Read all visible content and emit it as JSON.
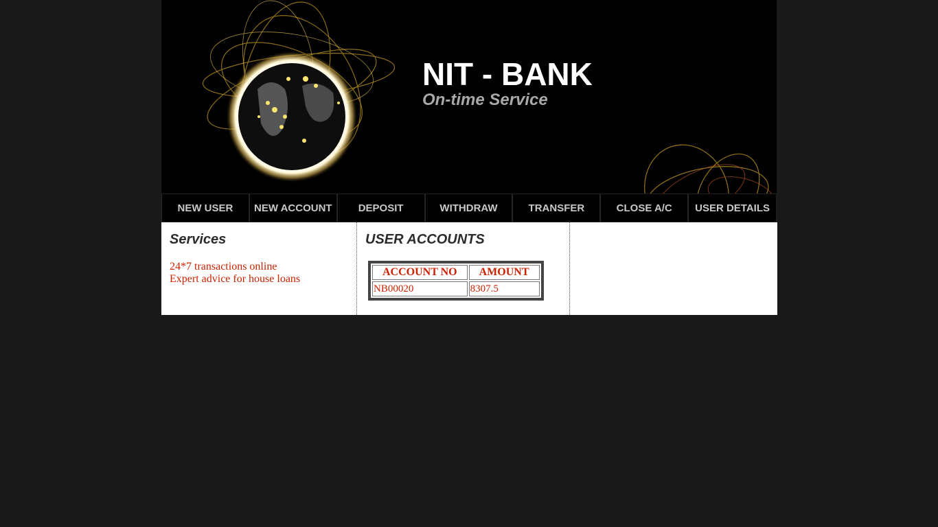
{
  "header": {
    "title": "NIT - BANK",
    "tagline": "On-time Service"
  },
  "nav": [
    {
      "label": "NEW USER"
    },
    {
      "label": "NEW ACCOUNT"
    },
    {
      "label": "DEPOSIT"
    },
    {
      "label": "WITHDRAW"
    },
    {
      "label": "TRANSFER"
    },
    {
      "label": "CLOSE A/C"
    },
    {
      "label": "USER DETAILS"
    }
  ],
  "services": {
    "heading": "Services",
    "items": [
      "24*7 transactions online",
      "Expert advice for house loans"
    ]
  },
  "accounts": {
    "heading": "USER ACCOUNTS",
    "columns": [
      "ACCOUNT NO",
      "AMOUNT"
    ],
    "rows": [
      {
        "account_no": "NB00020",
        "amount": "8307.5"
      }
    ]
  },
  "colors": {
    "page_bg": "#191919",
    "header_bg": "#000000",
    "accent_text": "#cc2200",
    "nav_text": "#c8c8c8",
    "tagline": "#a9a9a9"
  }
}
